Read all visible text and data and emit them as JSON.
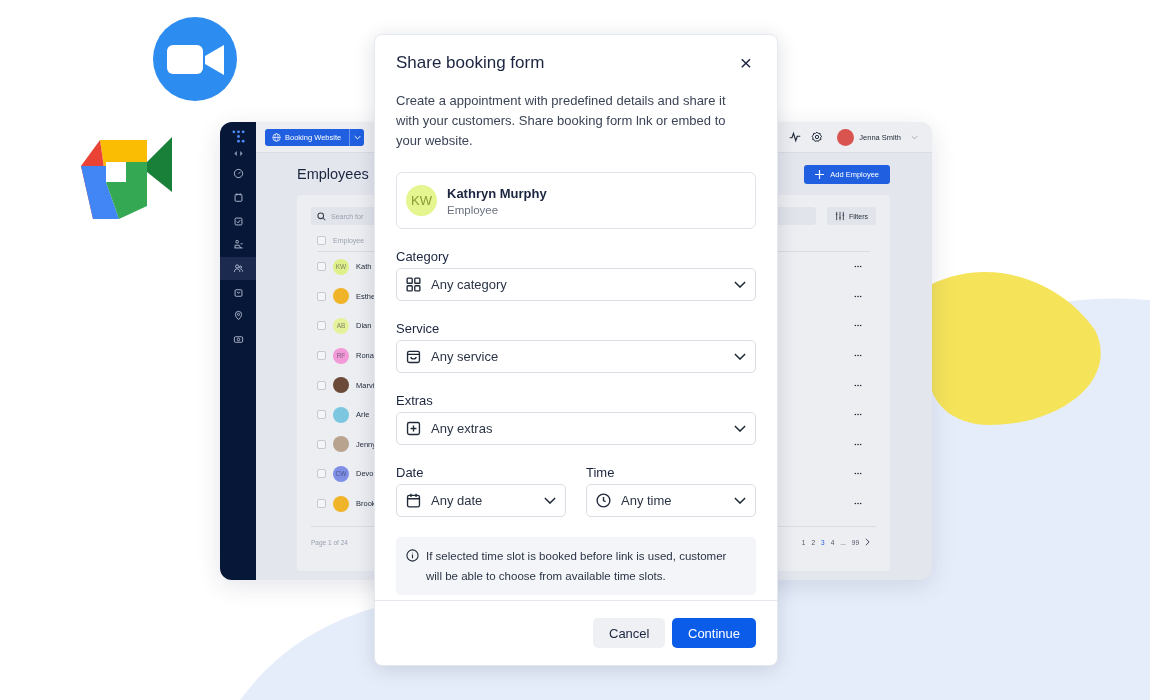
{
  "app": {
    "sidebar": {
      "items": [
        {
          "kind": "dashboard",
          "selected": false
        },
        {
          "kind": "calendar",
          "selected": false
        },
        {
          "kind": "tasks",
          "selected": false
        },
        {
          "kind": "desk",
          "selected": false
        },
        {
          "kind": "people",
          "selected": true
        },
        {
          "kind": "bag",
          "selected": false
        },
        {
          "kind": "location",
          "selected": false
        },
        {
          "kind": "cash",
          "selected": false
        }
      ]
    },
    "topbar": {
      "booking_button": "Booking Website",
      "user_name": "Jenna Smith"
    },
    "page_title": "Employees",
    "add_button": "Add Employee",
    "search": {
      "placeholder": "Search for"
    },
    "filters_button": "Filters",
    "table": {
      "column_header": "Employee",
      "header_checked": false,
      "rows": [
        {
          "name": "Kath",
          "initials": "KW",
          "color": "#dff08a",
          "checked": false
        },
        {
          "name": "Esthe",
          "initials": "",
          "color": "#f0b429",
          "checked": false
        },
        {
          "name": "Dian",
          "initials": "AB",
          "color": "#e6f29a",
          "checked": false
        },
        {
          "name": "Rona",
          "initials": "RF",
          "color": "#f29ad8",
          "checked": false
        },
        {
          "name": "Marvi",
          "initials": "",
          "color": "#6b4a3a",
          "checked": false
        },
        {
          "name": "Arle",
          "initials": "",
          "color": "#7cc6e0",
          "checked": false
        },
        {
          "name": "Jenny",
          "initials": "",
          "color": "#b8a48e",
          "checked": false
        },
        {
          "name": "Devo",
          "initials": "CW",
          "color": "#7f8fe6",
          "checked": false
        },
        {
          "name": "Brook",
          "initials": "",
          "color": "#f0b429",
          "checked": false
        }
      ]
    },
    "footer": {
      "page_info": "Page 1 of 24",
      "pages": [
        {
          "label": "1",
          "selected": false
        },
        {
          "label": "2",
          "selected": false
        },
        {
          "label": "3",
          "selected": true
        },
        {
          "label": "4",
          "selected": false
        },
        {
          "label": "...",
          "selected": false
        },
        {
          "label": "99",
          "selected": false
        }
      ]
    }
  },
  "dialog": {
    "title": "Share booking form",
    "close": "×",
    "description": "Create a appointment with predefined details and share it with your customers. Share booking form lnk or embed to your website.",
    "employee": {
      "initials": "KW",
      "name": "Kathryn Murphy",
      "role": "Employee"
    },
    "field_rows": [
      [
        {
          "kind": "category",
          "label": "Category",
          "value": "Any category"
        }
      ],
      [
        {
          "kind": "service",
          "label": "Service",
          "value": "Any service"
        }
      ],
      [
        {
          "kind": "extras",
          "label": "Extras",
          "value": "Any extras"
        }
      ],
      [
        {
          "kind": "date",
          "label": "Date",
          "value": "Any date"
        },
        {
          "kind": "time",
          "label": "Time",
          "value": "Any time"
        }
      ]
    ],
    "info": "If selected time slot is booked before link is used, customer will be able to choose from available time slots.",
    "buttons": [
      {
        "kind": "secondary",
        "label": "Cancel"
      },
      {
        "kind": "primary",
        "label": "Continue"
      }
    ]
  }
}
